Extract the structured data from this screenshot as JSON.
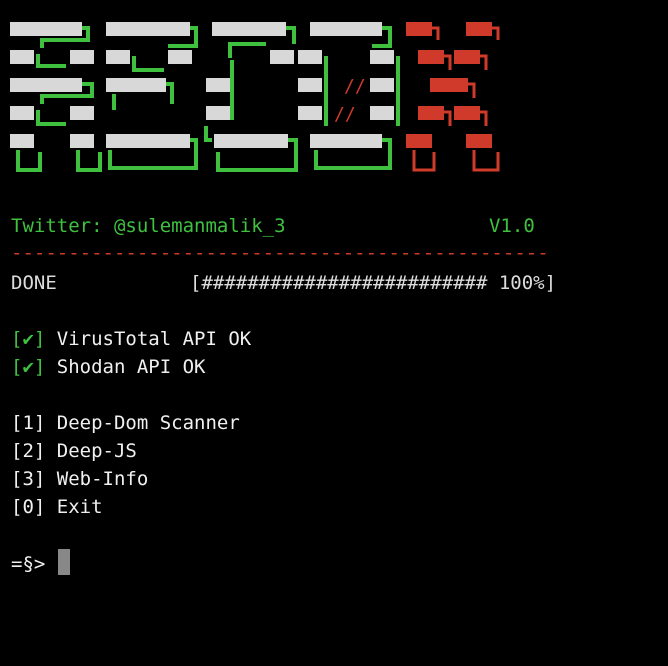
{
  "banner": {
    "name": "ASCII art logo",
    "colors": {
      "green": "#3fc13f",
      "white": "#d8d8d8",
      "red": "#d03a2a"
    }
  },
  "header": {
    "twitter": "Twitter: @sulemanmalik_3",
    "version": "V1.0",
    "divider": "-----------------------------------------------"
  },
  "status": {
    "label": "DONE",
    "bar": "[######################### 100%]",
    "progress_percent": 100
  },
  "checks": [
    {
      "mark": "[✔]",
      "text": "VirusTotal API OK"
    },
    {
      "mark": "[✔]",
      "text": "Shodan API OK"
    }
  ],
  "menu": [
    {
      "key": "[1]",
      "label": "Deep-Dom Scanner"
    },
    {
      "key": "[2]",
      "label": "Deep-JS"
    },
    {
      "key": "[3]",
      "label": "Web-Info"
    },
    {
      "key": "[0]",
      "label": "Exit"
    }
  ],
  "prompt": {
    "text": "=§>"
  }
}
